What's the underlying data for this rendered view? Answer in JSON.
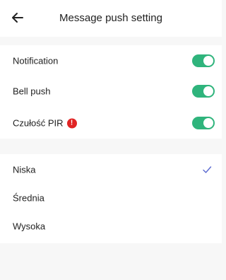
{
  "header": {
    "title": "Message push setting",
    "back_icon": "arrow-left-icon"
  },
  "toggles": [
    {
      "label": "Notification",
      "on": true
    },
    {
      "label": "Bell push",
      "on": true
    },
    {
      "label": "Czułość PIR",
      "on": true,
      "warning_icon": "exclamation-icon",
      "warning_glyph": "!"
    }
  ],
  "sensitivity_options": [
    {
      "label": "Niska",
      "selected": true
    },
    {
      "label": "Średnia",
      "selected": false
    },
    {
      "label": "Wysoka",
      "selected": false
    }
  ],
  "colors": {
    "accent": "#2fb47c",
    "check": "#5b6ad0",
    "warning": "#e02424"
  }
}
